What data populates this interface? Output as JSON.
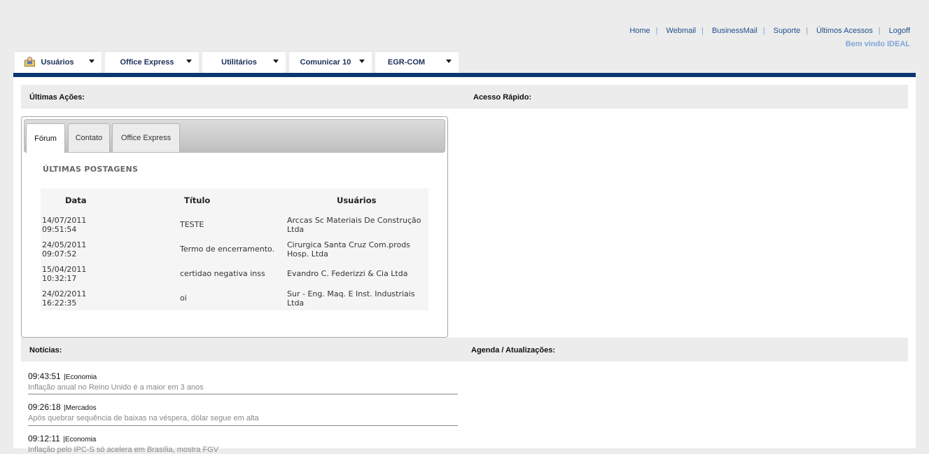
{
  "top_links": [
    "Home",
    "Webmail",
    "BusinessMail",
    "Suporte",
    "Últimos Acessos",
    "Logoff"
  ],
  "welcome": "Bem vindo IDEAL",
  "menu": [
    {
      "label": "Usuários"
    },
    {
      "label": "Office Express"
    },
    {
      "label": "Utilitários"
    },
    {
      "label": "Comunicar 10"
    },
    {
      "label": "EGR-COM"
    }
  ],
  "sections": {
    "ultimas_acoes": "Últimas Ações:",
    "acesso_rapido": "Acesso Rápido:",
    "noticias": "Notícias:",
    "agenda": "Agenda / Atualizações:"
  },
  "tabs": [
    "Fórum",
    "Contato",
    "Office Express"
  ],
  "posts": {
    "title": "ÚLTIMAS POSTAGENS",
    "columns": [
      "Data",
      "Título",
      "Usuários"
    ],
    "rows": [
      {
        "date": "14/07/2011",
        "time": "09:51:54",
        "title": "TESTE",
        "user_line1": "Arccas Sc Materiais De Construção",
        "user_line2": "Ltda"
      },
      {
        "date": "24/05/2011",
        "time": "09:07:52",
        "title": "Termo de encerramento.",
        "user_line1": "Cirurgica Santa Cruz Com.prods",
        "user_line2": "Hosp. Ltda"
      },
      {
        "date": "15/04/2011",
        "time": "10:32:17",
        "title": "certidao negativa inss",
        "user_line1": "Evandro C. Federizzi & Cia Ltda",
        "user_line2": ""
      },
      {
        "date": "24/02/2011",
        "time": "16:22:35",
        "title": "oi",
        "user_line1": "Sur - Eng. Maq. E Inst. Industriais",
        "user_line2": "Ltda"
      }
    ]
  },
  "news": [
    {
      "time": "09:43:51",
      "category": "|Economia",
      "headline": "Inflação anual no Reino Unido é a maior em 3 anos"
    },
    {
      "time": "09:26:18",
      "category": "|Mercados",
      "headline": "Após quebrar sequência de baixas na véspera, dólar segue em alta"
    },
    {
      "time": "09:12:11",
      "category": "|Economia",
      "headline": "Inflação pelo IPC-S só acelera em Brasília, mostra FGV"
    }
  ]
}
